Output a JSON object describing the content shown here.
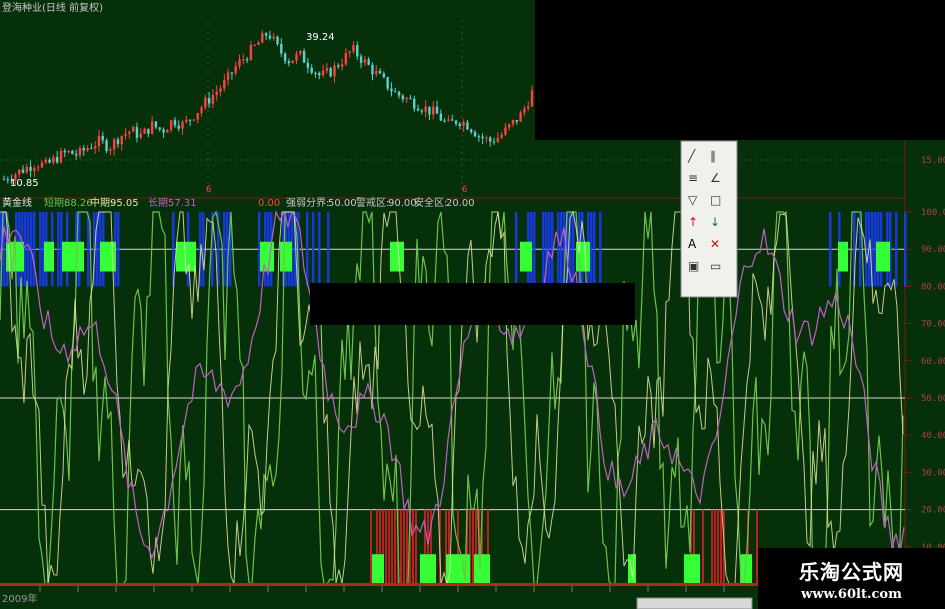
{
  "header": {
    "title": "登海种业(日线 前复权)"
  },
  "price_panel": {
    "peak_label": "39.24",
    "low_label": "10.85",
    "axis_label": "15.00",
    "marker_label": "6"
  },
  "indicator_header": {
    "name": "黄金线",
    "short_label": "短期:",
    "short_value": "88.26",
    "mid_label": "中期:",
    "mid_value": "95.05",
    "long_label": "长期:",
    "long_value": "57.31",
    "zero_value": "0.00",
    "strong_weak_label": "强弱分界:",
    "strong_weak_value": "50.00",
    "alert_label": "警戒区:",
    "alert_value": "90.00",
    "safe_label": "安全区:",
    "safe_value": "20.00"
  },
  "y_axis": [
    "100.0",
    "90.00",
    "80.00",
    "70.00",
    "60.00",
    "50.00",
    "40.00",
    "30.00",
    "20.00",
    "10.00"
  ],
  "toolbar": {
    "tools": [
      "line-tool-icon",
      "parallel-tool-icon",
      "channel-tool-icon",
      "fan-tool-icon",
      "triangle-tool-icon",
      "rect-tool-icon",
      "up-arrow-icon",
      "down-arrow-icon",
      "text-tool-icon",
      "delete-icon",
      "save-icon",
      "frame-icon"
    ]
  },
  "footer": {
    "date_label": "2009年"
  },
  "watermark": {
    "title": "乐淘公式网",
    "url": "www.60lt.com"
  },
  "colors": {
    "background": "#05300a",
    "price_up": "#ff4040",
    "price_down": "#5fd0d0",
    "short_line": "#6ec24a",
    "mid_line": "#e8e8a0",
    "long_line": "#c060c0",
    "alert_band": "#1a3cff",
    "buy_bar": "#35ff35"
  },
  "chart_data": [
    {
      "type": "candlestick",
      "title": "登海种业(日线 前复权)",
      "close_path": [
        12,
        13,
        14,
        15,
        14.5,
        16,
        17,
        16.5,
        18,
        19,
        18,
        20,
        21,
        20,
        22,
        21,
        23,
        22,
        24,
        26,
        28,
        30,
        33,
        35,
        37,
        39.24,
        36,
        34,
        35,
        33,
        31,
        32,
        34,
        36,
        34,
        32,
        30,
        28,
        27,
        26,
        25,
        24,
        22,
        23,
        22,
        20,
        19,
        20,
        22,
        24,
        28
      ],
      "labels": [
        "39.24",
        "10.85"
      ]
    },
    {
      "type": "line",
      "title": "黄金线",
      "ylim": [
        0,
        100
      ],
      "reference_lines": [
        90,
        50,
        20
      ],
      "series": [
        {
          "name": "短期",
          "last": 88.26
        },
        {
          "name": "中期",
          "last": 95.05
        },
        {
          "name": "长期",
          "last": 57.31
        }
      ]
    }
  ]
}
